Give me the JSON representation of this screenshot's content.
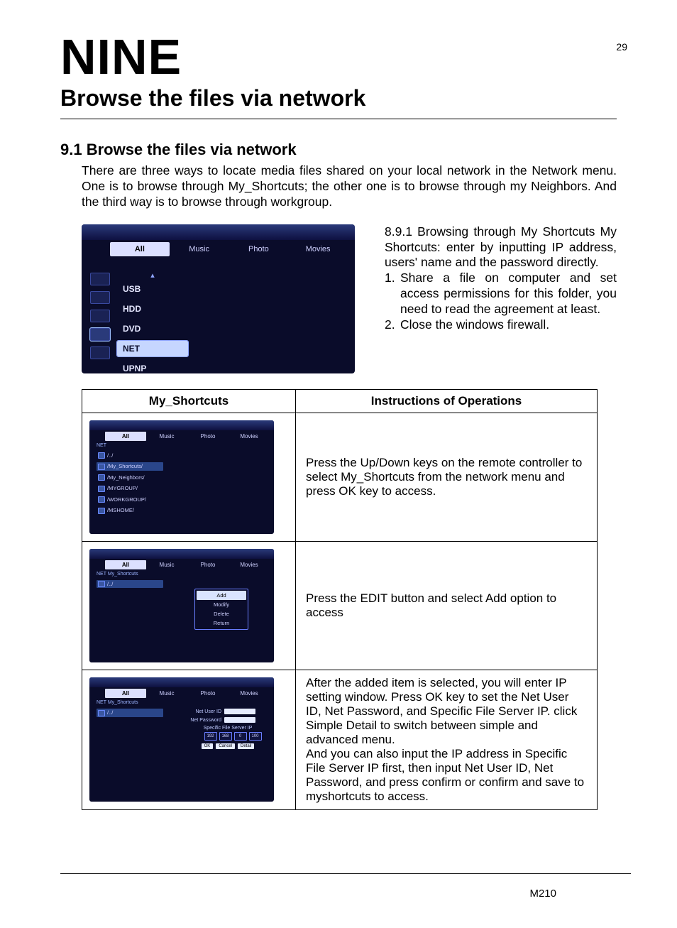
{
  "page_number": "29",
  "chapter_label": "NINE",
  "title": "Browse the files via network",
  "section_heading": "9.1 Browse the files via network",
  "intro": "There are three ways to locate media files shared on your local network in the Network menu. One is to browse through My_Shortcuts; the other one is to browse through my Neighbors. And the third way is to browse through workgroup.",
  "figure_main": {
    "tabs": [
      "All",
      "Music",
      "Photo",
      "Movies"
    ],
    "side_items": [
      "USB",
      "HDD",
      "DVD",
      "NET",
      "UPNP"
    ],
    "selected_tab_index": 0,
    "selected_side_index": 3
  },
  "right_col": {
    "heading": "8.9.1 Browsing through My Shortcuts",
    "p1": "My Shortcuts: enter by inputting IP address, users' name and the password directly.",
    "item1_num": "1.",
    "item1": "Share a file on computer and set access permissions for this folder, you need to read the agreement at least.",
    "item2_num": "2.",
    "item2": "Close the windows firewall."
  },
  "table": {
    "header1": "My_Shortcuts",
    "header2": "Instructions of Operations",
    "row1": {
      "crumb": "NET",
      "items": [
        "/../",
        "/My_Shortcuts/",
        "/My_Neighbors/",
        "/MYGROUP/",
        "/WORKGROUP/",
        "/MSHOME/"
      ],
      "text": "Press the Up/Down keys on the remote controller to select My_Shortcuts from the network menu and press OK key to access."
    },
    "row2": {
      "crumb": "NET My_Shortcuts",
      "items": [
        "/../"
      ],
      "menu": [
        "Add",
        "Modify",
        "Delete",
        "Return"
      ],
      "text": "Press the EDIT button and select Add option to access"
    },
    "row3": {
      "crumb": "NET My_Shortcuts",
      "items": [
        "/../"
      ],
      "fields": {
        "user": "Net User ID",
        "pass": "Net Password",
        "ip": "Specific File Server IP",
        "ip_parts": [
          "192",
          "168",
          "0",
          "100"
        ],
        "buttons": [
          "OK",
          "Cancel",
          "Detail"
        ]
      },
      "text": "After the added item is selected, you will enter IP setting window. Press OK key to set the Net User ID, Net Password, and Specific File Server IP. click Simple Detail to switch between simple and advanced menu.\nAnd you can also input the IP address in Specific File Server IP first, then input Net User ID, Net Password, and press confirm or confirm and save to myshortcuts to access."
    }
  },
  "footer_model": "M210"
}
